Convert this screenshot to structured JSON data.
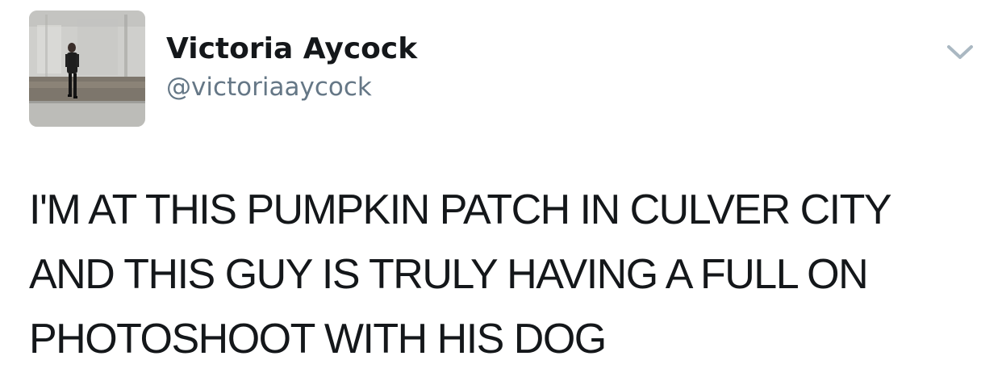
{
  "author": {
    "display_name": "Victoria Aycock",
    "handle": "@victoriaaycock",
    "avatar_icon": "user-photo-avatar"
  },
  "tweet": {
    "text_lines": [
      "I'M AT THIS PUMPKIN PATCH IN CULVER CITY",
      "AND THIS GUY IS TRULY HAVING A FULL ON",
      "PHOTOSHOOT WITH HIS DOG"
    ]
  },
  "menu": {
    "icon": "chevron-down-icon"
  },
  "colors": {
    "text_primary": "#14171a",
    "text_secondary": "#657786",
    "caret": "#aab8c2"
  }
}
